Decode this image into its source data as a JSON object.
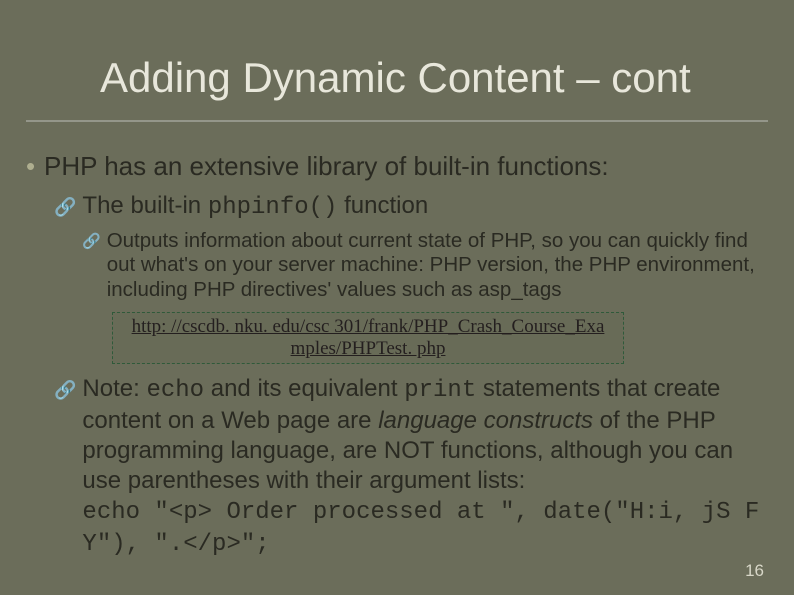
{
  "title": "Adding Dynamic Content – cont",
  "bullet1": "PHP has an extensive library of built-in functions:",
  "sub1": {
    "pre": "The built-in ",
    "code": "phpinfo()",
    "post": " function"
  },
  "sub1detail": "Outputs information about current state of PHP, so you can quickly find out what's on your server machine: PHP version, the PHP environment, including PHP directives' values such as asp_tags",
  "link_url": "http: //cscdb. nku. edu/csc 301/frank/PHP_Crash_Course_Exa mples/PHPTest. php",
  "note": {
    "pre": "Note: ",
    "code1": "echo",
    "mid1": " and its equivalent ",
    "code2": "print",
    "mid2": " statements that create content on a Web page are ",
    "italic": "language constructs",
    "post": " of the PHP programming language, are NOT functions, although you can use parentheses with their argument lists:"
  },
  "code_line": "echo \"<p> Order processed at \", date(\"H:i, jS F Y\"), \".</p>\";",
  "page": "16"
}
